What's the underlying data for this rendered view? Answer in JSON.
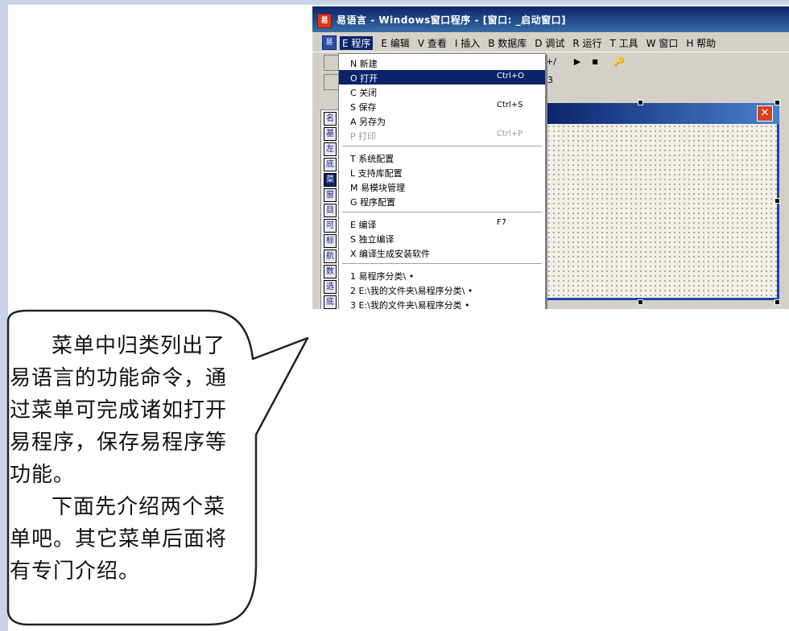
{
  "window": {
    "title": "易语言 - Windows窗口程序 - [窗口: _启动窗口]",
    "app_icon_glyph": "易",
    "menubar_icon_glyph": "易",
    "menus": [
      "E 程序",
      "E 编辑",
      "V 查看",
      "I 插入",
      "B 数据库",
      "D 调试",
      "R 运行",
      "T 工具",
      "W 窗口",
      "H 帮助"
    ]
  },
  "toolbar": {
    "row1_text": "+/",
    "run_glyph": "▶",
    "stop_glyph": "■",
    "key_glyph": "🔑",
    "row2_text": "3"
  },
  "left_panel": {
    "buttons": [
      "名",
      "基",
      "左",
      "底",
      "菜",
      "窗",
      "目",
      "可",
      "标",
      "航",
      "数",
      "选",
      "底"
    ]
  },
  "dropdown": {
    "items": [
      {
        "label": "N 新建",
        "shortcut": ""
      },
      {
        "label": "O 打开",
        "shortcut": "Ctrl+O"
      },
      {
        "label": "C 关闭",
        "shortcut": ""
      },
      {
        "label": "S 保存",
        "shortcut": "Ctrl+S"
      },
      {
        "label": "A 另存为",
        "shortcut": ""
      },
      {
        "label": "P 打印",
        "shortcut": "Ctrl+P"
      },
      {
        "label": "T 系统配置",
        "shortcut": ""
      },
      {
        "label": "L 支持库配置",
        "shortcut": ""
      },
      {
        "label": "M 易模块管理",
        "shortcut": ""
      },
      {
        "label": "G 程序配置",
        "shortcut": ""
      },
      {
        "label": "E 编译",
        "shortcut": "F7"
      },
      {
        "label": "S 独立编译",
        "shortcut": ""
      },
      {
        "label": "X 编译生成安装软件",
        "shortcut": ""
      },
      {
        "label": "1 易程序分类\\ •",
        "shortcut": ""
      },
      {
        "label": "2 E:\\我的文件夹\\易程序分类\\ •",
        "shortcut": ""
      },
      {
        "label": "3 E:\\我的文件夹\\易程序分类 •",
        "shortcut": ""
      }
    ]
  },
  "form": {
    "close_glyph": "✕"
  },
  "bubble": {
    "para1": "菜单中归类列出了易语言的功能命令，通过菜单可完成诸如打开易程序，保存易程序等功能。",
    "para2": "下面先介绍两个菜单吧。其它菜单后面将有专门介绍。"
  }
}
